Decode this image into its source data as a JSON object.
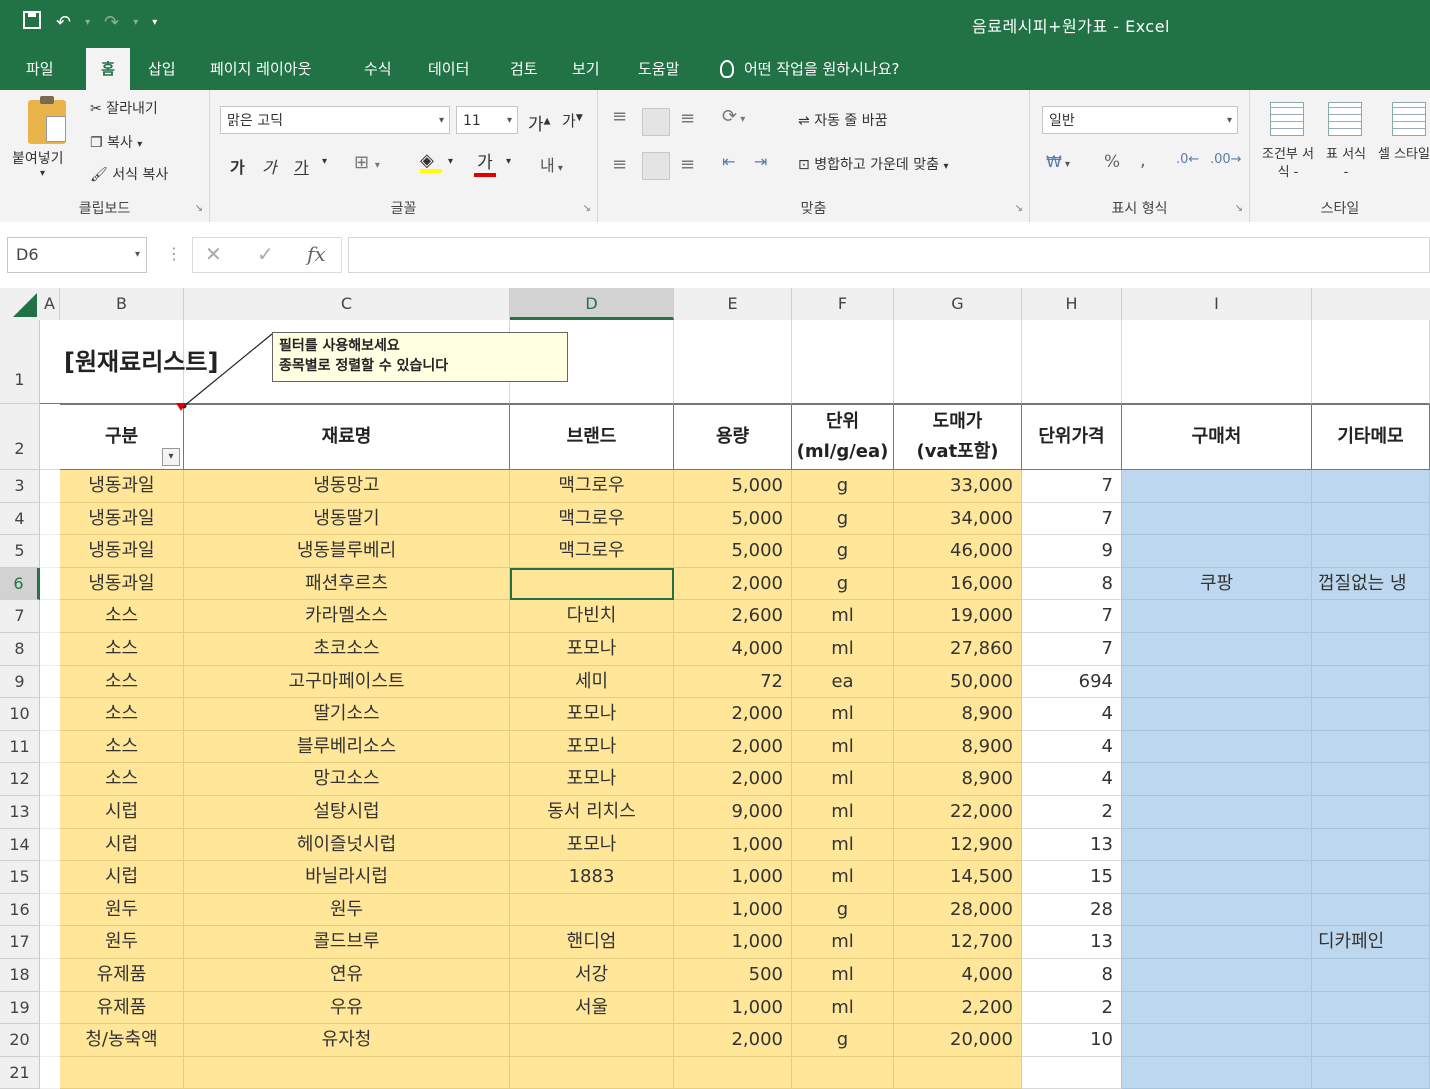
{
  "title_bar": {
    "title": "음료레시피+원가표 - Excel"
  },
  "ribbon_tabs": [
    "파일",
    "홈",
    "삽입",
    "페이지 레이아웃",
    "수식",
    "데이터",
    "검토",
    "보기",
    "도움말"
  ],
  "tell_me": "어떤 작업을 원하시나요?",
  "ribbon": {
    "clipboard": {
      "label": "클립보드",
      "paste": "붙여넣기",
      "cut": "잘라내기",
      "copy": "복사",
      "format_painter": "서식 복사"
    },
    "font": {
      "label": "글꼴",
      "font_name": "맑은 고딕",
      "font_size": "11",
      "bold": "가",
      "italic": "가",
      "underline": "가",
      "font_color_letter": "가"
    },
    "alignment": {
      "label": "맞춤",
      "wrap_text": "자동 줄 바꿈",
      "merge_center": "병합하고 가운데 맞춤"
    },
    "number": {
      "label": "표시 형식",
      "format": "일반",
      "percent": "%"
    },
    "styles": {
      "label": "스타일",
      "conditional": "조건부 서식 -",
      "table": "표 서식 -",
      "cell": "셀 스타일"
    }
  },
  "formula_bar": {
    "name_box": "D6",
    "fx": "fx"
  },
  "columns": [
    "A",
    "B",
    "C",
    "D",
    "E",
    "F",
    "G",
    "H",
    "I"
  ],
  "selected_column": "D",
  "row_numbers": [
    "1",
    "2",
    "3",
    "4",
    "5",
    "6",
    "7",
    "8",
    "9",
    "10",
    "11",
    "12",
    "13",
    "14",
    "15",
    "16",
    "17",
    "18",
    "19",
    "20",
    "21"
  ],
  "selected_row": "6",
  "sheet": {
    "title": "[원재료리스트]",
    "note_lines": [
      "필터를 사용해보세요",
      "종목별로 정렬할 수 있습니다"
    ],
    "headers": {
      "category": "구분",
      "name": "재료명",
      "brand": "브랜드",
      "volume": "용량",
      "unit_line1": "단위",
      "unit_line2": "(ml/g/ea)",
      "wholesale_line1": "도매가",
      "wholesale_line2": "(vat포함)",
      "unit_price": "단위가격",
      "purchase": "구매처",
      "memo": "기타메모"
    },
    "rows": [
      {
        "category": "냉동과일",
        "name": "냉동망고",
        "brand": "맥그로우",
        "volume": "5,000",
        "unit": "g",
        "price": "33,000",
        "unit_price": "7",
        "purchase": "",
        "memo": ""
      },
      {
        "category": "냉동과일",
        "name": "냉동딸기",
        "brand": "맥그로우",
        "volume": "5,000",
        "unit": "g",
        "price": "34,000",
        "unit_price": "7",
        "purchase": "",
        "memo": ""
      },
      {
        "category": "냉동과일",
        "name": "냉동블루베리",
        "brand": "맥그로우",
        "volume": "5,000",
        "unit": "g",
        "price": "46,000",
        "unit_price": "9",
        "purchase": "",
        "memo": ""
      },
      {
        "category": "냉동과일",
        "name": "패션후르츠",
        "brand": "",
        "volume": "2,000",
        "unit": "g",
        "price": "16,000",
        "unit_price": "8",
        "purchase": "쿠팡",
        "memo": "껍질없는 냉"
      },
      {
        "category": "소스",
        "name": "카라멜소스",
        "brand": "다빈치",
        "volume": "2,600",
        "unit": "ml",
        "price": "19,000",
        "unit_price": "7",
        "purchase": "",
        "memo": ""
      },
      {
        "category": "소스",
        "name": "초코소스",
        "brand": "포모나",
        "volume": "4,000",
        "unit": "ml",
        "price": "27,860",
        "unit_price": "7",
        "purchase": "",
        "memo": ""
      },
      {
        "category": "소스",
        "name": "고구마페이스트",
        "brand": "세미",
        "volume": "72",
        "unit": "ea",
        "price": "50,000",
        "unit_price": "694",
        "purchase": "",
        "memo": ""
      },
      {
        "category": "소스",
        "name": "딸기소스",
        "brand": "포모나",
        "volume": "2,000",
        "unit": "ml",
        "price": "8,900",
        "unit_price": "4",
        "purchase": "",
        "memo": ""
      },
      {
        "category": "소스",
        "name": "블루베리소스",
        "brand": "포모나",
        "volume": "2,000",
        "unit": "ml",
        "price": "8,900",
        "unit_price": "4",
        "purchase": "",
        "memo": ""
      },
      {
        "category": "소스",
        "name": "망고소스",
        "brand": "포모나",
        "volume": "2,000",
        "unit": "ml",
        "price": "8,900",
        "unit_price": "4",
        "purchase": "",
        "memo": ""
      },
      {
        "category": "시럽",
        "name": "설탕시럽",
        "brand": "동서 리치스",
        "volume": "9,000",
        "unit": "ml",
        "price": "22,000",
        "unit_price": "2",
        "purchase": "",
        "memo": ""
      },
      {
        "category": "시럽",
        "name": "헤이즐넛시럽",
        "brand": "포모나",
        "volume": "1,000",
        "unit": "ml",
        "price": "12,900",
        "unit_price": "13",
        "purchase": "",
        "memo": ""
      },
      {
        "category": "시럽",
        "name": "바닐라시럽",
        "brand": "1883",
        "volume": "1,000",
        "unit": "ml",
        "price": "14,500",
        "unit_price": "15",
        "purchase": "",
        "memo": ""
      },
      {
        "category": "원두",
        "name": "원두",
        "brand": "",
        "volume": "1,000",
        "unit": "g",
        "price": "28,000",
        "unit_price": "28",
        "purchase": "",
        "memo": ""
      },
      {
        "category": "원두",
        "name": "콜드브루",
        "brand": "핸디엄",
        "volume": "1,000",
        "unit": "ml",
        "price": "12,700",
        "unit_price": "13",
        "purchase": "",
        "memo": "디카페인"
      },
      {
        "category": "유제품",
        "name": "연유",
        "brand": "서강",
        "volume": "500",
        "unit": "ml",
        "price": "4,000",
        "unit_price": "8",
        "purchase": "",
        "memo": ""
      },
      {
        "category": "유제품",
        "name": "우유",
        "brand": "서울",
        "volume": "1,000",
        "unit": "ml",
        "price": "2,200",
        "unit_price": "2",
        "purchase": "",
        "memo": ""
      },
      {
        "category": "청/농축액",
        "name": "유자청",
        "brand": "",
        "volume": "2,000",
        "unit": "g",
        "price": "20,000",
        "unit_price": "10",
        "purchase": "",
        "memo": ""
      }
    ]
  }
}
